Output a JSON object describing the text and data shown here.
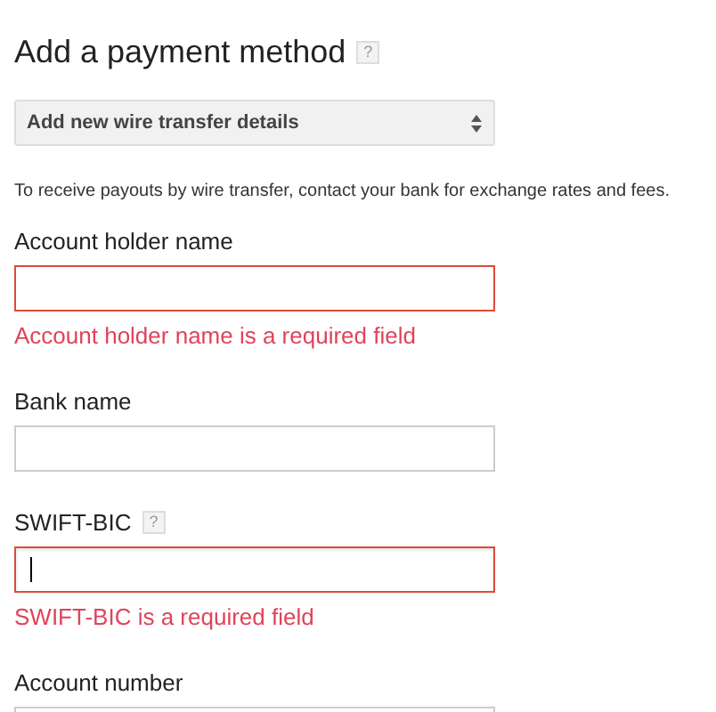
{
  "title": "Add a payment method",
  "title_help": "?",
  "select": {
    "value": "Add new wire transfer details"
  },
  "info": "To receive payouts by wire transfer, contact your bank for exchange rates and fees.",
  "fields": [
    {
      "label": "Account holder name",
      "invalid": true,
      "focused": false,
      "error": "Account holder name is a required field"
    },
    {
      "label": "Bank name",
      "invalid": false,
      "focused": false
    },
    {
      "label": "SWIFT-BIC",
      "help": "?",
      "invalid": true,
      "focused": true,
      "error": "SWIFT-BIC is a required field"
    },
    {
      "label": "Account number"
    }
  ]
}
